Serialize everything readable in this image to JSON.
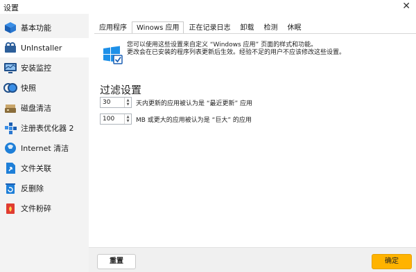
{
  "window": {
    "title": "设置",
    "close_glyph": "✕"
  },
  "sidebar": {
    "items": [
      {
        "label": "基本功能",
        "icon": "cube-icon"
      },
      {
        "label": "UnInstaller",
        "icon": "uninstaller-icon"
      },
      {
        "label": "安装监控",
        "icon": "monitor-icon"
      },
      {
        "label": "快照",
        "icon": "snapshot-icon"
      },
      {
        "label": "磁盘清洁",
        "icon": "disk-clean-icon"
      },
      {
        "label": "注册表优化器 2",
        "icon": "registry-icon"
      },
      {
        "label": "Internet 清洁",
        "icon": "internet-icon"
      },
      {
        "label": "文件关联",
        "icon": "file-association-icon"
      },
      {
        "label": "反删除",
        "icon": "undelete-icon"
      },
      {
        "label": "文件粉碎",
        "icon": "shredder-icon"
      }
    ],
    "active_index": 1
  },
  "tabs": [
    "应用程序",
    "Winows 应用",
    "正在记录日志",
    "卸载",
    "检测",
    "休眠"
  ],
  "active_tab": 1,
  "info": {
    "line1": "您可以使用这些设置来自定义 “Windows 应用” 页面的样式和功能。",
    "line2": "更改会在已安装的程序列表更新后生效。经验不足的用户不应该修改这些设置。"
  },
  "filter": {
    "title": "过滤设置",
    "days_value": "30",
    "days_desc": "天内更新的应用被认为是 “最近更新” 应用",
    "size_value": "100",
    "size_desc": "MB 或更大的应用被认为是 “巨大” 的应用"
  },
  "footer": {
    "reset_label": "重置",
    "ok_label": "确定"
  },
  "colors": {
    "accent": "#ffb300",
    "sidebar_bg": "#f3f3f3",
    "footer_bg": "#f0f0f0"
  }
}
